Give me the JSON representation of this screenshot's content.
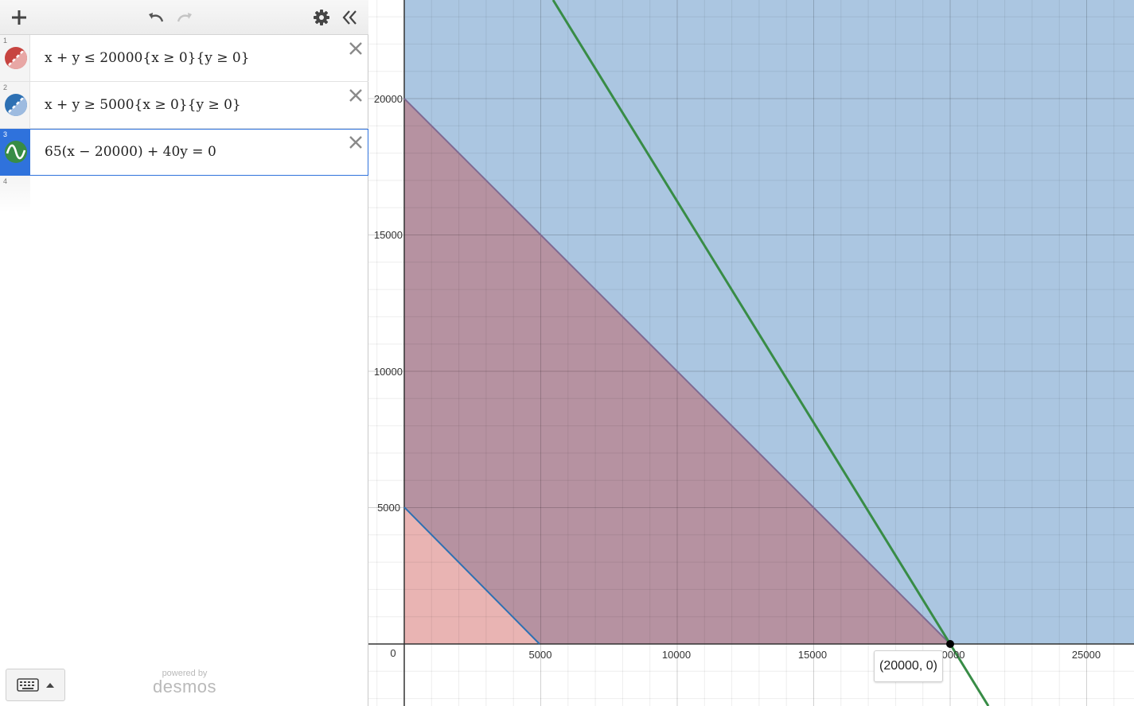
{
  "header": {
    "add_icon": "plus-icon",
    "undo_icon": "undo-icon",
    "redo_icon": "redo-icon",
    "settings_icon": "gear-icon",
    "collapse_icon": "double-chevron-left-icon"
  },
  "expressions": [
    {
      "number": "1",
      "latex": "x + y ≤ 20000{x ≥ 0}{y ≥ 0}",
      "color": "#c74440",
      "kind": "inequality",
      "active": false
    },
    {
      "number": "2",
      "latex": "x + y ≥ 5000{x ≥ 0}{y ≥ 0}",
      "color": "#2d70b3",
      "kind": "inequality",
      "active": false
    },
    {
      "number": "3",
      "latex": "65(x − 20000) + 40y = 0",
      "color": "#388c46",
      "kind": "curve",
      "active": true
    },
    {
      "number": "4",
      "latex": "",
      "color": "",
      "kind": "empty",
      "active": false
    }
  ],
  "footer": {
    "keyboard_icon": "keyboard-icon",
    "powered_by": "powered by",
    "brand": "desmos"
  },
  "graph": {
    "x_ticks": [
      "0",
      "5000",
      "10000",
      "15000",
      "0000",
      "25000"
    ],
    "y_ticks": [
      "5000",
      "10000",
      "15000",
      "20000"
    ],
    "point_label": "(20000, 0)",
    "region_colors": {
      "red": "#c74440",
      "blue": "#2d70b3",
      "green": "#388c46"
    }
  }
}
